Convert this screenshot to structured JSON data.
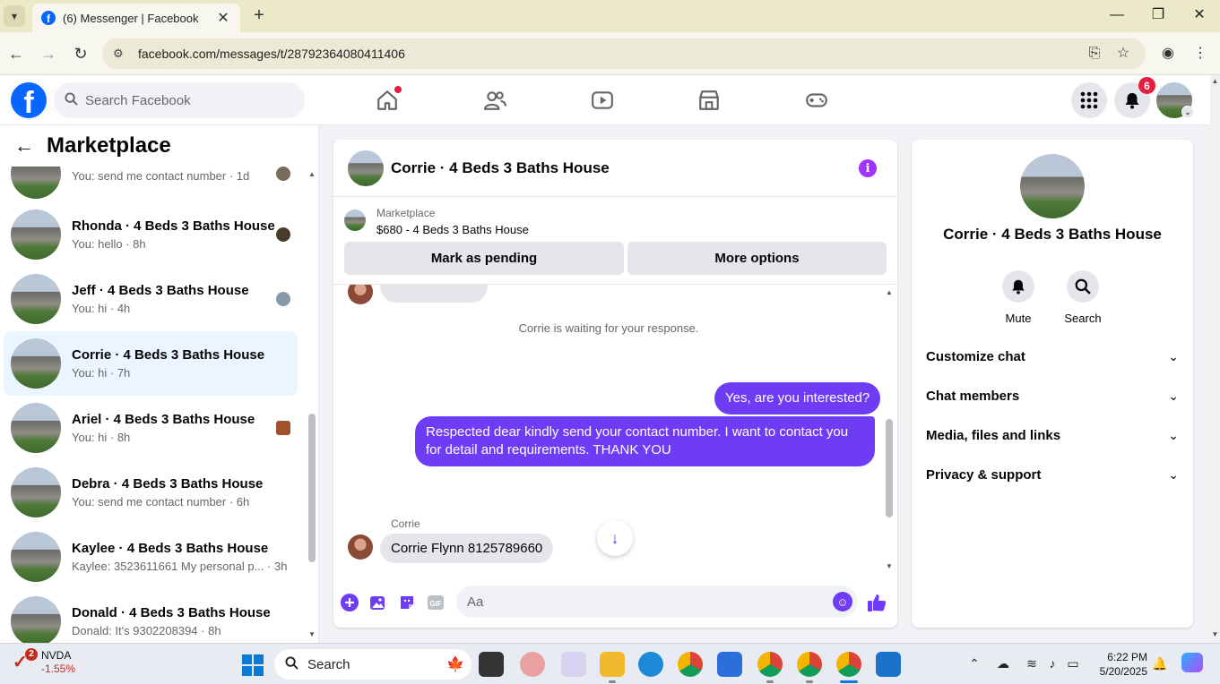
{
  "browser": {
    "tab_title": "(6) Messenger | Facebook",
    "tab_close": "✕",
    "new_tab": "+",
    "url": "facebook.com/messages/t/28792364080411406",
    "colors": {
      "tabbar": "#ece9c8",
      "omnibox": "#ece9d6"
    }
  },
  "fb_header": {
    "logo": "f",
    "search_placeholder": "Search Facebook",
    "notification_count": "6",
    "icons": [
      "home-icon",
      "friends-icon",
      "video-icon",
      "marketplace-icon",
      "gaming-icon",
      "menu-grid-icon",
      "bell-icon"
    ]
  },
  "sidebar": {
    "title": "Marketplace",
    "conversations": [
      {
        "name": "",
        "preview": "You: send me contact number · 1d"
      },
      {
        "name": "Rhonda · 4 Beds 3 Baths House",
        "preview": "You: hello · 8h"
      },
      {
        "name": "Jeff · 4 Beds 3 Baths House",
        "preview": "You: hi · 4h"
      },
      {
        "name": "Corrie · 4 Beds 3 Baths House",
        "preview": "You: hi · 7h"
      },
      {
        "name": "Ariel · 4 Beds 3 Baths House",
        "preview": "You: hi · 8h"
      },
      {
        "name": "Debra · 4 Beds 3 Baths House",
        "preview": "You: send me contact number · 6h"
      },
      {
        "name": "Kaylee · 4 Beds 3 Baths House",
        "preview": "Kaylee: 3523611661 My personal p... · 3h"
      },
      {
        "name": "Donald · 4 Beds 3 Baths House",
        "preview": "Donald: It's 9302208394 · 8h"
      }
    ]
  },
  "chat": {
    "title": "Corrie · 4 Beds 3 Baths House",
    "listing_label": "Marketplace",
    "listing_price": "$680 - 4 Beds 3 Baths House",
    "mark_pending": "Mark as pending",
    "more_options": "More options",
    "waiting_note": "Corrie is waiting for your response.",
    "out_msg_1": "Yes, are you interested?",
    "out_msg_2": "Respected dear kindly send your contact number. I want to contact you for detail and requirements. THANK YOU",
    "sender_name": "Corrie",
    "in_msg": "Corrie Flynn 8125789660",
    "composer_placeholder": "Aa",
    "accent_color": "#6e3cf5"
  },
  "info_panel": {
    "name": "Corrie · 4 Beds 3 Baths House",
    "mute_label": "Mute",
    "search_label": "Search",
    "sections": [
      "Customize chat",
      "Chat members",
      "Media, files and links",
      "Privacy & support"
    ]
  },
  "taskbar": {
    "stock_symbol": "NVDA",
    "stock_change": "-1.55%",
    "stock_badge": "2",
    "search_label": "Search",
    "time": "6:22 PM",
    "date": "5/20/2025"
  }
}
